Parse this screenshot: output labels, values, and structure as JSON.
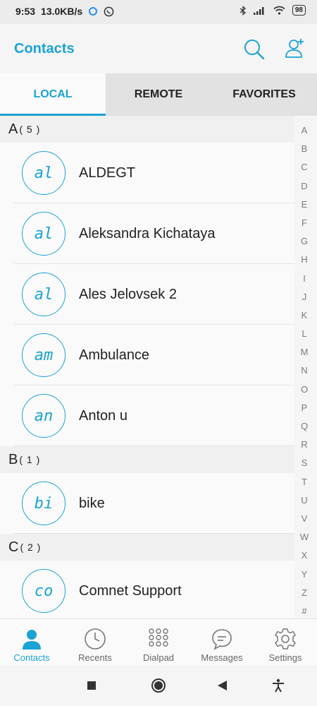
{
  "status_bar": {
    "time": "9:53",
    "speed": "13.0KB/s",
    "battery": "98"
  },
  "header": {
    "title": "Contacts"
  },
  "tabs": [
    {
      "label": "LOCAL",
      "active": true
    },
    {
      "label": "REMOTE",
      "active": false
    },
    {
      "label": "FAVORITES",
      "active": false
    }
  ],
  "sections": [
    {
      "letter": "A",
      "count": "( 5 )",
      "contacts": [
        {
          "initials": "al",
          "name": "ALDEGT"
        },
        {
          "initials": "al",
          "name": "Aleksandra Kichataya"
        },
        {
          "initials": "al",
          "name": "Ales Jelovsek 2"
        },
        {
          "initials": "am",
          "name": "Ambulance"
        },
        {
          "initials": "an",
          "name": "Anton u"
        }
      ]
    },
    {
      "letter": "B",
      "count": "( 1 )",
      "contacts": [
        {
          "initials": "bi",
          "name": "bike"
        }
      ]
    },
    {
      "letter": "C",
      "count": "( 2 )",
      "contacts": [
        {
          "initials": "co",
          "name": "Comnet Support"
        }
      ]
    }
  ],
  "alphabet": [
    "A",
    "B",
    "C",
    "D",
    "E",
    "F",
    "G",
    "H",
    "I",
    "J",
    "K",
    "L",
    "M",
    "N",
    "O",
    "P",
    "Q",
    "R",
    "S",
    "T",
    "U",
    "V",
    "W",
    "X",
    "Y",
    "Z",
    "#"
  ],
  "bottom_nav": [
    {
      "label": "Contacts",
      "icon": "person-icon",
      "active": true
    },
    {
      "label": "Recents",
      "icon": "clock-icon",
      "active": false
    },
    {
      "label": "Dialpad",
      "icon": "dialpad-icon",
      "active": false
    },
    {
      "label": "Messages",
      "icon": "message-icon",
      "active": false
    },
    {
      "label": "Settings",
      "icon": "gear-icon",
      "active": false
    }
  ],
  "colors": {
    "accent": "#1aa3d4"
  }
}
